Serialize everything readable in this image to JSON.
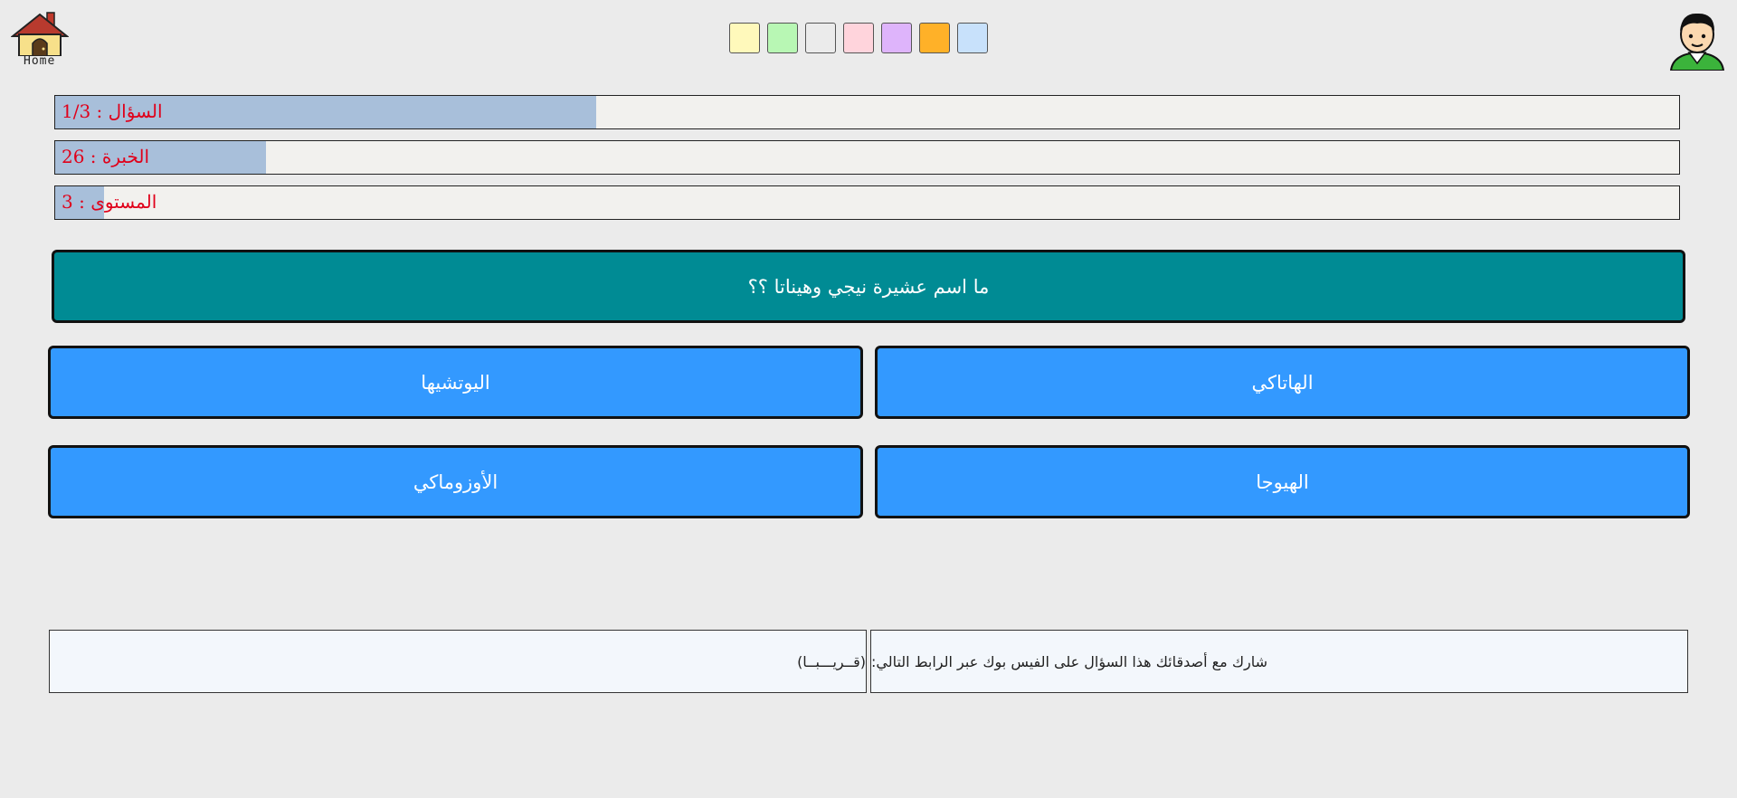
{
  "header": {
    "home_label": "Home",
    "home_icon": "house-icon",
    "avatar_icon": "user-avatar-icon",
    "swatches": [
      {
        "color": "#fff9bb"
      },
      {
        "color": "#b8f7b4"
      },
      {
        "color": "#ebebeb"
      },
      {
        "color": "#ffd4dc"
      },
      {
        "color": "#deb4fb"
      },
      {
        "color": "#ffb128"
      },
      {
        "color": "#c8e1fb"
      }
    ]
  },
  "progress": {
    "question": {
      "label": "السؤال : 1/3",
      "fraction": 0.333
    },
    "experience": {
      "label": "الخبرة : 26",
      "fraction": 0.13
    },
    "level": {
      "label": "المستوى : 3",
      "fraction": 0.03
    }
  },
  "question": {
    "text": "ما اسم عشيرة نيجي وهيناتا ؟؟"
  },
  "answers": {
    "top_right": "الهاتاكي",
    "top_left": "اليوتشيها",
    "bottom_right": "الهيوجا",
    "bottom_left": "الأوزوماكي"
  },
  "footer": {
    "share_text": "شارك مع أصدقائك هذا السؤال على الفيس بوك عبر الرابط التالي:",
    "link_text": "(قــريـــبــا)"
  },
  "colors": {
    "background": "#ebebeb",
    "question_bg": "#008b94",
    "answer_bg": "#3399ff",
    "progress_fill": "#a8bfda",
    "progress_text": "#e0001a"
  }
}
